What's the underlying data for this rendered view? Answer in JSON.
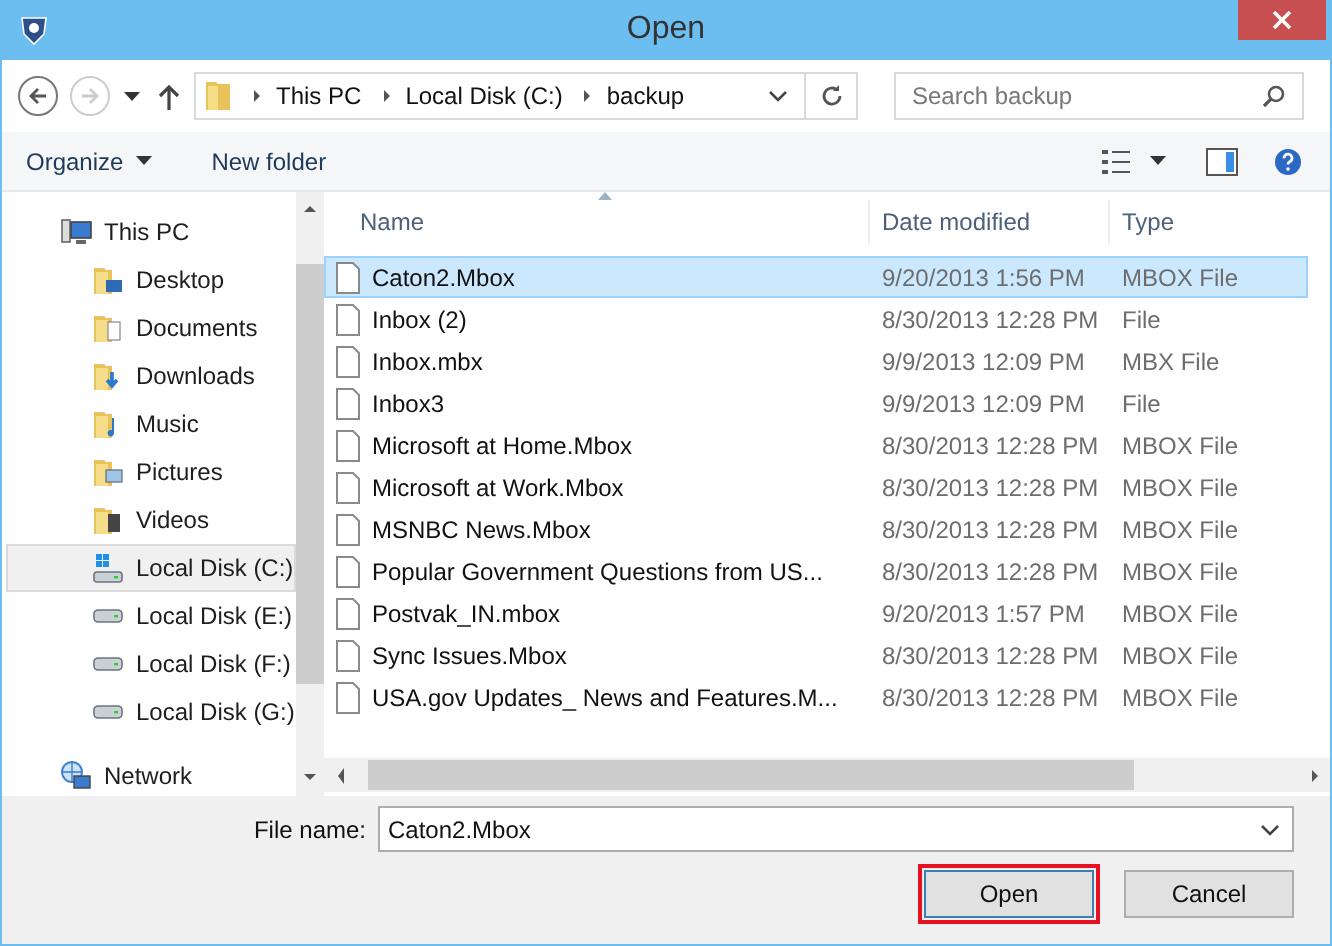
{
  "window": {
    "title": "Open"
  },
  "address": {
    "crumbs": [
      "This PC",
      "Local Disk (C:)",
      "backup"
    ],
    "search_placeholder": "Search backup"
  },
  "toolbar": {
    "organize": "Organize",
    "new_folder": "New folder"
  },
  "sidebar": {
    "items": [
      {
        "label": "This PC",
        "kind": "pc",
        "selected": false,
        "children": [
          {
            "label": "Desktop",
            "kind": "desktop",
            "selected": false
          },
          {
            "label": "Documents",
            "kind": "documents",
            "selected": false
          },
          {
            "label": "Downloads",
            "kind": "downloads",
            "selected": false
          },
          {
            "label": "Music",
            "kind": "music",
            "selected": false
          },
          {
            "label": "Pictures",
            "kind": "pictures",
            "selected": false
          },
          {
            "label": "Videos",
            "kind": "videos",
            "selected": false
          },
          {
            "label": "Local Disk (C:)",
            "kind": "system-disk",
            "selected": true
          },
          {
            "label": "Local Disk (E:)",
            "kind": "disk",
            "selected": false
          },
          {
            "label": "Local Disk (F:)",
            "kind": "disk",
            "selected": false
          },
          {
            "label": "Local Disk (G:)",
            "kind": "disk",
            "selected": false
          }
        ]
      },
      {
        "label": "Network",
        "kind": "network",
        "selected": false
      }
    ]
  },
  "table": {
    "columns": [
      "Name",
      "Date modified",
      "Type"
    ],
    "rows": [
      {
        "name": "Caton2.Mbox",
        "date": "9/20/2013 1:56 PM",
        "type": "MBOX File",
        "selected": true
      },
      {
        "name": "Inbox (2)",
        "date": "8/30/2013 12:28 PM",
        "type": "File",
        "selected": false
      },
      {
        "name": "Inbox.mbx",
        "date": "9/9/2013 12:09 PM",
        "type": "MBX File",
        "selected": false
      },
      {
        "name": "Inbox3",
        "date": "9/9/2013 12:09 PM",
        "type": "File",
        "selected": false
      },
      {
        "name": "Microsoft at Home.Mbox",
        "date": "8/30/2013 12:28 PM",
        "type": "MBOX File",
        "selected": false
      },
      {
        "name": "Microsoft at Work.Mbox",
        "date": "8/30/2013 12:28 PM",
        "type": "MBOX File",
        "selected": false
      },
      {
        "name": "MSNBC News.Mbox",
        "date": "8/30/2013 12:28 PM",
        "type": "MBOX File",
        "selected": false
      },
      {
        "name": "Popular Government Questions from US...",
        "date": "8/30/2013 12:28 PM",
        "type": "MBOX File",
        "selected": false
      },
      {
        "name": "Postvak_IN.mbox",
        "date": "9/20/2013 1:57 PM",
        "type": "MBOX File",
        "selected": false
      },
      {
        "name": "Sync Issues.Mbox",
        "date": "8/30/2013 12:28 PM",
        "type": "MBOX File",
        "selected": false
      },
      {
        "name": "USA.gov Updates_ News and Features.M...",
        "date": "8/30/2013 12:28 PM",
        "type": "MBOX File",
        "selected": false
      }
    ]
  },
  "file_name": {
    "label": "File name:",
    "value": "Caton2.Mbox"
  },
  "buttons": [
    {
      "label": "Open",
      "kind": "primary"
    },
    {
      "label": "Cancel",
      "kind": "secondary"
    }
  ]
}
